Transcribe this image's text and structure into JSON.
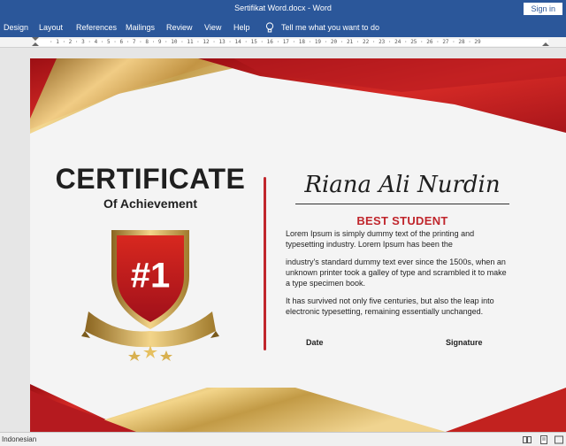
{
  "window": {
    "title": "Sertifikat Word.docx  -  Word",
    "signin_label": "Sign in"
  },
  "ribbon": {
    "tabs": [
      "Design",
      "Layout",
      "References",
      "Mailings",
      "Review",
      "View",
      "Help"
    ],
    "tell_me": "Tell me what you want to do"
  },
  "ruler": {
    "numbers": "· 1 · 2 · 3 · 4 · 5 · 6 · 7 · 8 · 9 · 10 · 11 · 12 · 13 · 14 · 15 · 16 · 17 · 18 · 19 · 20 · 21 · 22 · 23 · 24 · 25 · 26 · 27 · 28 · 29"
  },
  "certificate": {
    "title": "CERTIFICATE",
    "subtitle": "Of Achievement",
    "badge_text": "#1",
    "name": "Riana Ali Nurdin",
    "award": "BEST STUDENT",
    "paragraph_1": "Lorem Ipsum is simply dummy text of the printing and typesetting industry. Lorem Ipsum has been the",
    "paragraph_2": "industry's standard dummy text ever since the 1500s, when an unknown printer took a galley of type and scrambled it to make a type specimen book.",
    "paragraph_3": " It has survived not only five centuries, but also the leap into electronic typesetting, remaining essentially unchanged.",
    "date_label": "Date",
    "signature_label": "Signature"
  },
  "status": {
    "language": "Indonesian"
  },
  "colors": {
    "word_blue": "#2b579a",
    "cert_red": "#c0262c",
    "gold": "#c9a24a"
  }
}
